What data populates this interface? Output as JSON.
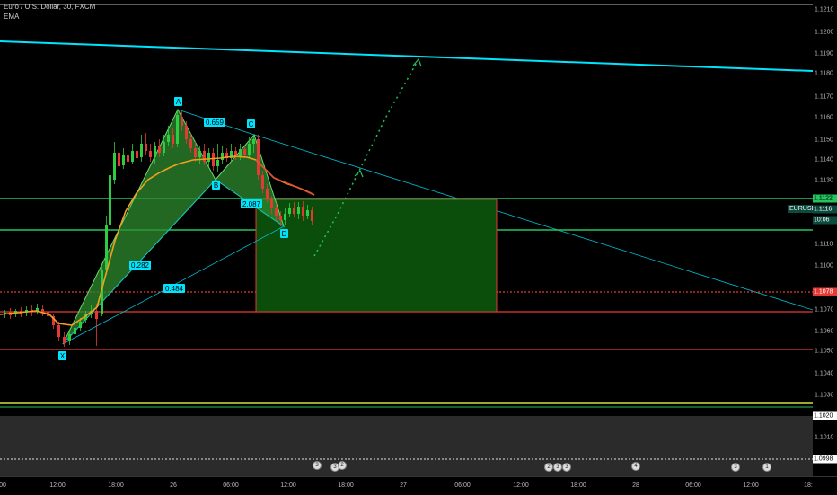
{
  "legend": {
    "symbol_line": "Euro / U.S. Dollar, 30, FXCM",
    "indicator": "EMA"
  },
  "pattern_points": {
    "X": "X",
    "A": "A",
    "B": "B",
    "C": "C",
    "D": "D"
  },
  "ratios": {
    "xa_ab": "0.659",
    "ab_bc": "0.282",
    "xb": "0.484",
    "bc_cd": "2.087"
  },
  "price_axis": {
    "ticks": [
      "1.1210",
      "1.1200",
      "1.1190",
      "1.1180",
      "1.1170",
      "1.1160",
      "1.1150",
      "1.1140",
      "1.1130",
      "1.1110",
      "1.1100",
      "1.1090",
      "1.1070",
      "1.1060",
      "1.1050",
      "1.1040",
      "1.1030",
      "1.1010",
      "1.1000"
    ],
    "tag_upper": "1.1122",
    "tag_current": "1.1116",
    "tag_countdown": "10:06",
    "tag_red": "1.1078",
    "tag_lower_yellow": "1.1020",
    "tag_bottom": "1.0998",
    "symbol_tag": "EURUSD · 1.1116"
  },
  "time_axis": {
    "labels": [
      "00",
      "12:00",
      "18:00",
      "26",
      "06:00",
      "12:00",
      "18:00",
      "27",
      "06:00",
      "12:00",
      "18:00",
      "28",
      "06:00",
      "12:00",
      "18:"
    ]
  },
  "events": [
    "3",
    "3",
    "2",
    "2",
    "3",
    "3",
    "4",
    "3",
    "1"
  ],
  "colors": {
    "cyan": "#00e5ff",
    "green_line": "#22c55e",
    "red_line": "#e53935",
    "yellow_line": "#d4e03a",
    "box_fill": "#0b4d0b",
    "ema": "#f0a020"
  }
}
